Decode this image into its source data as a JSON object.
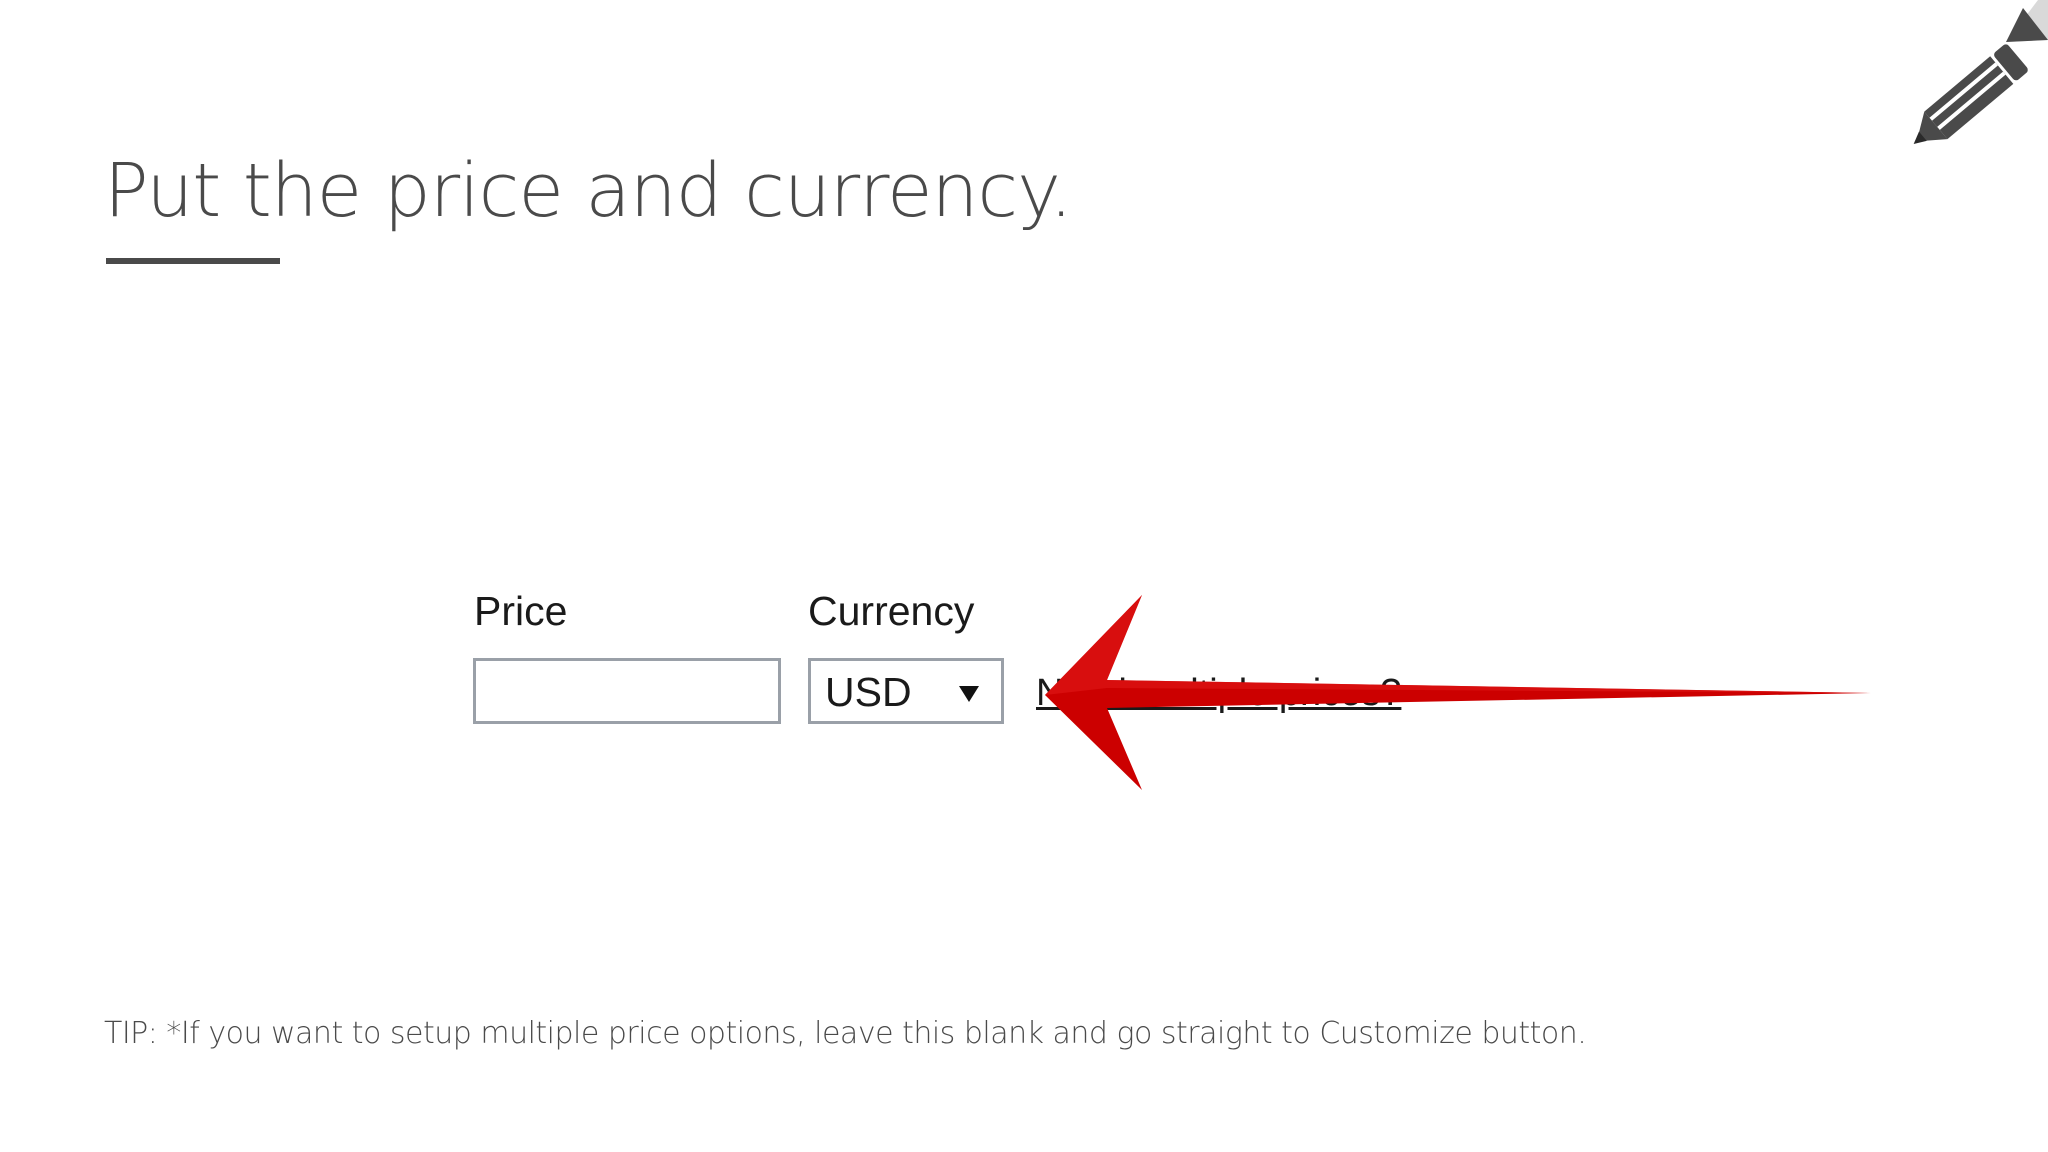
{
  "slide": {
    "title": "Put the price and currency.",
    "tip": "TIP: *If you want to setup multiple price options, leave this blank and go straight to Customize button.",
    "corner_icon": "pencil-icon"
  },
  "form": {
    "price_label": "Price",
    "price_value": "",
    "currency_label": "Currency",
    "currency_selected": "USD",
    "multiple_prices_link": "Need multiple prices?"
  },
  "annotation": {
    "arrow_color": "#cc0000",
    "arrow_icon": "arrow-left-icon"
  },
  "colors": {
    "title_text": "#4a4a4a",
    "field_border": "#9aa0a8"
  }
}
